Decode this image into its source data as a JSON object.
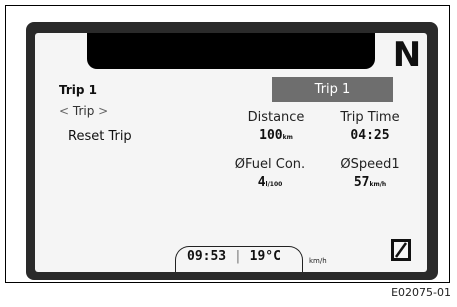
{
  "gear": "N",
  "menu": {
    "title": "Trip 1",
    "nav_prev": "<",
    "nav_label": "Trip",
    "nav_next": ">",
    "item": "Reset Trip"
  },
  "panel": {
    "header": "Trip 1",
    "metrics": [
      {
        "label": "Distance",
        "value": "100",
        "unit": "km"
      },
      {
        "label": "Trip Time",
        "value": "04:25",
        "unit": ""
      },
      {
        "label": "ØFuel Con.",
        "value": "4",
        "unit": "l/100"
      },
      {
        "label": "ØSpeed1",
        "value": "57",
        "unit": "km/h"
      }
    ]
  },
  "status": {
    "time": "09:53",
    "temperature": "19°C",
    "speed_unit": "km/h"
  },
  "figure_id": "E02075-01"
}
